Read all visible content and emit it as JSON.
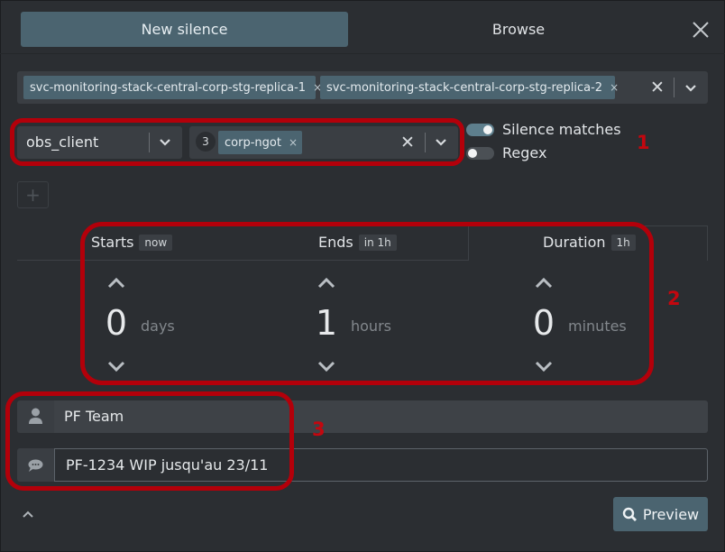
{
  "tabs": {
    "new_silence": "New silence",
    "browse": "Browse"
  },
  "clusters": {
    "selected": [
      "svc-monitoring-stack-central-corp-stg-replica-1",
      "svc-monitoring-stack-central-corp-stg-replica-2"
    ],
    "clear_glyph": "✕",
    "chip_remove_glyph": "×"
  },
  "matcher": {
    "label_name": "obs_client",
    "value_count": "3",
    "values": [
      "corp-ngot"
    ],
    "clear_glyph": "✕"
  },
  "toggles": {
    "silence_matches": {
      "label": "Silence matches",
      "on": true
    },
    "regex": {
      "label": "Regex",
      "on": false
    }
  },
  "add_matcher_glyph": "+",
  "time": {
    "starts": {
      "label": "Starts",
      "badge": "now"
    },
    "ends": {
      "label": "Ends",
      "badge": "in 1h"
    },
    "duration": {
      "label": "Duration",
      "badge": "1h"
    },
    "days": {
      "value": "0",
      "unit": "days"
    },
    "hours": {
      "value": "1",
      "unit": "hours"
    },
    "minutes": {
      "value": "0",
      "unit": "minutes"
    }
  },
  "author": {
    "value": "PF Team",
    "icon": "user-icon"
  },
  "comment": {
    "value": "PF-1234 WIP jusqu'au 23/11",
    "icon": "comment-icon"
  },
  "preview_button": {
    "label": "Preview",
    "icon": "search-icon"
  },
  "annotations": {
    "one": "1",
    "two": "2",
    "three": "3"
  },
  "colors": {
    "accent": "#4b6470",
    "background": "#2b2e32",
    "annotation": "#b3000a"
  }
}
